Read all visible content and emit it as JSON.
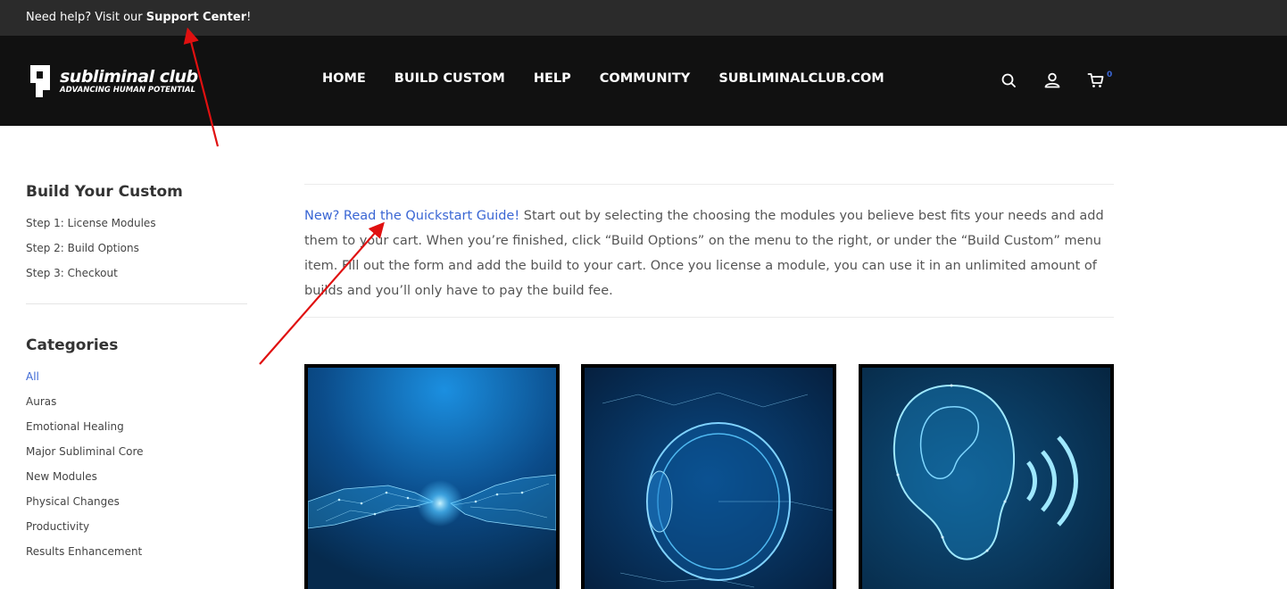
{
  "topbar": {
    "prefix": "Need help? Visit our ",
    "link": "Support Center",
    "suffix": "!"
  },
  "brand": {
    "name": "subliminal club",
    "tagline": "ADVANCING HUMAN POTENTIAL"
  },
  "nav": {
    "items": [
      "HOME",
      "BUILD CUSTOM",
      "HELP",
      "COMMUNITY",
      "SUBLIMINALCLUB.COM"
    ]
  },
  "header_icons": {
    "search": "search-icon",
    "account": "user-icon",
    "cart": "cart-icon",
    "cart_count": "0"
  },
  "sidebar": {
    "build_heading": "Build Your Custom",
    "build_steps": [
      "Step 1: License Modules",
      "Step 2: Build Options",
      "Step 3: Checkout"
    ],
    "categories_heading": "Categories",
    "categories": [
      "All",
      "Auras",
      "Emotional Healing",
      "Major Subliminal Core",
      "New Modules",
      "Physical Changes",
      "Productivity",
      "Results Enhancement"
    ]
  },
  "intro": {
    "link": "New? Read the Quickstart Guide!",
    "text": " Start out by selecting the choosing the modules you believe best fits your needs and add them to your cart. When you’re finished, click “Build Options” on the menu to the right, or under the “Build Custom” menu item. Fill out the form and add the build to your cart. Once you license a module, you can use it in an unlimited amount of builds and you’ll only have to pay the build fee."
  },
  "tiles": [
    {
      "icon": "hands-touching-image"
    },
    {
      "icon": "eye-anatomy-image"
    },
    {
      "icon": "ear-sound-image"
    }
  ],
  "colors": {
    "accent": "#3a66d4",
    "topbar": "#2b2b2b",
    "header": "#111111",
    "annotation": "#e01010"
  }
}
